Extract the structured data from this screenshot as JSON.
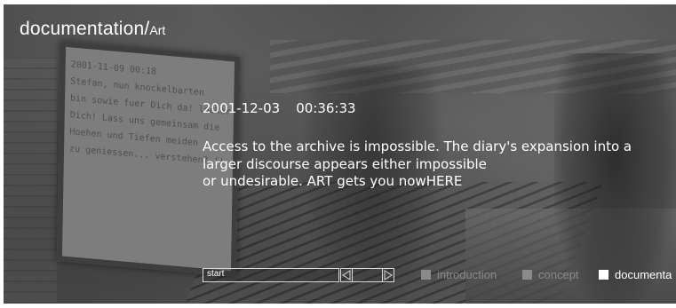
{
  "header": {
    "title": "documentation/",
    "subtitle": "Art"
  },
  "entry": {
    "date": "2001-12-03",
    "time": "00:36:33",
    "lines": [
      "Access to the archive is impossible. The diary's expansion into a",
      "larger discourse appears either impossible",
      "or undesirable. ART gets you nowHERE"
    ]
  },
  "navigation": {
    "start_label": "start",
    "prev_icon": "triangle-left-icon",
    "next_icon": "triangle-right-icon",
    "items": [
      {
        "label": "introduction",
        "state": "inactive"
      },
      {
        "label": "concept",
        "state": "inactive"
      },
      {
        "label": "documenta",
        "state": "active"
      }
    ]
  },
  "poster": {
    "lines": [
      "2001-11-09 00:18",
      "Stefan, nun knockelbarten",
      "bin sowie fuer Dich da! locker",
      "Dich! Lass uns gemeinsam die",
      "Hoehen und Tiefen meiden",
      "zu geniessen... verstehen? !!"
    ]
  },
  "colors": {
    "text": "#ffffff",
    "inactive": "#8a8a8a",
    "border": "#d8d8d8"
  }
}
